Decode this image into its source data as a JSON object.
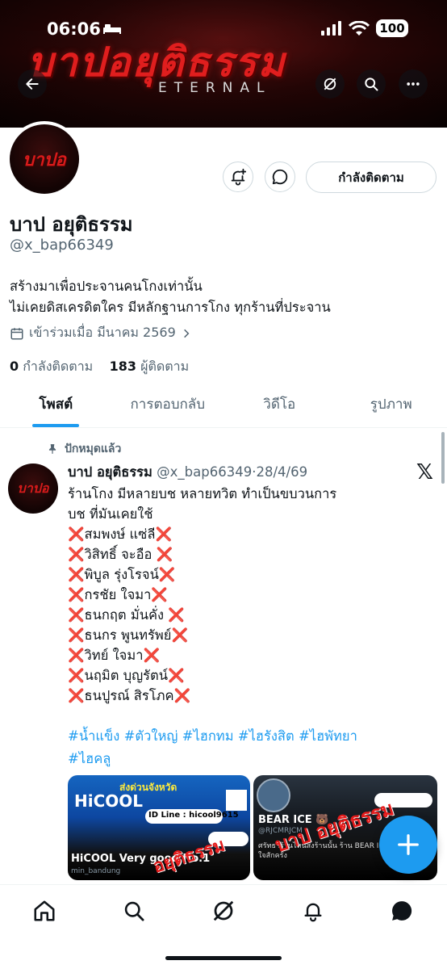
{
  "status_bar": {
    "time": "06:06",
    "battery": "100"
  },
  "banner": {
    "title": "บาปอยุติธรรม",
    "subtitle": "ETERNAL"
  },
  "avatar_text": "บาปอ",
  "actions": {
    "follow_label": "กำลังติดตาม"
  },
  "profile": {
    "name": "บาป อยุติธรรม",
    "handle": "@x_bap66349",
    "bio_line1": "สร้างมาเพื่อประจานคนโกงเท่านั้น",
    "bio_line2": "ไม่เคยดิสเครดิตใคร มีหลักฐานการโกง ทุกร้านที่ประจาน",
    "joined": "เข้าร่วมเมื่อ มีนาคม 2569",
    "following_count": "0",
    "following_label": "กำลังติดตาม",
    "followers_count": "183",
    "followers_label": "ผู้ติดตาม"
  },
  "tabs": [
    {
      "label": "โพสต์"
    },
    {
      "label": "การตอบกลับ"
    },
    {
      "label": "วิดีโอ"
    },
    {
      "label": "รูปภาพ"
    }
  ],
  "post": {
    "pinned_label": "ปักหมุดแล้ว",
    "author": "บาป อยุติธรรม",
    "handle": "@x_bap66349",
    "date": "28/4/69",
    "text_line1": "ร้านโกง  มีหลายบช หลายทวิต ทำเป็นขบวนการ",
    "text_line2": "บช ที่มันเคยใช้",
    "names": [
      "สมพงษ์ แซ่ลี",
      "วิสิทธิ์ จะอือ",
      "พิบูล รุ่งโรจน์",
      "กรชัย  ใจมา",
      "ธนกฤต มั่นคั่ง",
      "ธนกร พูนทรัพย์",
      "วิทย์ ใจมา",
      "นฤมิต บุญรัตน์",
      "ธนปูรณ์ สิรโภค"
    ],
    "hashtags_line1": "#น้ำแข็ง #ตัวใหญ่ #ไฮกทม #ไฮรังสิต #ไฮพัทยา",
    "hashtags_line2": "#ไฮคลู",
    "media": [
      {
        "header": "ส่งด่วนจังหวัด",
        "brand": "HiCOOL",
        "line_id": "ID Line : hicool9615",
        "title": "HiCOOL Very good No.1",
        "sub": "min_bandung",
        "watermark": "อยุติธรรม"
      },
      {
        "brand": "BEAR ICE 🐻",
        "sub": "@RJCMRJCM",
        "desc": "ศรัทธาร้านไหนส่งร้านนั้น ร้าน BEAR ICE",
        "desc2": "ใจสักครั้ง",
        "watermark": "บาป อยุติธรรม"
      }
    ]
  },
  "bottom_nav": [
    "home-icon",
    "search-icon",
    "grok-icon",
    "notifications-icon",
    "messages-icon"
  ]
}
